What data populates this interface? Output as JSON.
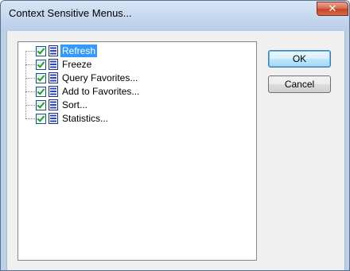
{
  "window": {
    "title": "Context Sensitive Menus..."
  },
  "tree": {
    "items": [
      {
        "label": "Refresh",
        "checked": true,
        "selected": true
      },
      {
        "label": "Freeze",
        "checked": true,
        "selected": false
      },
      {
        "label": "Query Favorites...",
        "checked": true,
        "selected": false
      },
      {
        "label": "Add to Favorites...",
        "checked": true,
        "selected": false
      },
      {
        "label": "Sort...",
        "checked": true,
        "selected": false
      },
      {
        "label": "Statistics...",
        "checked": true,
        "selected": false
      }
    ]
  },
  "buttons": {
    "ok_label": "OK",
    "cancel_label": "Cancel"
  },
  "colors": {
    "selection": "#3399ff",
    "close_button": "#c7442a"
  },
  "icons": {
    "close": "close-icon",
    "item": "menu-item-icon",
    "checkbox": "checkbox-checked"
  }
}
